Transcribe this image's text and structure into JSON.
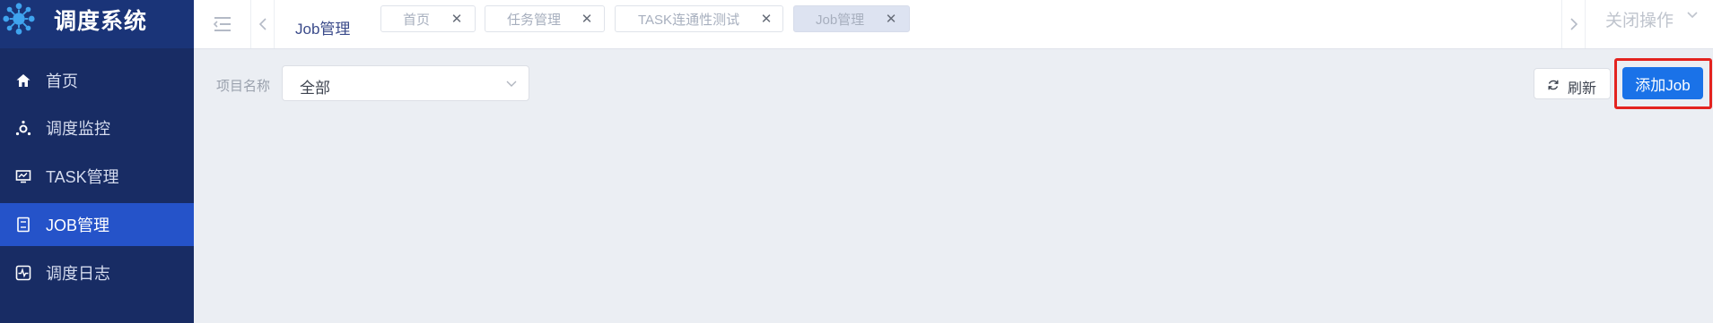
{
  "app": {
    "title": "调度系统"
  },
  "sidebar": {
    "items": [
      {
        "label": "首页",
        "icon": "home-icon",
        "active": false
      },
      {
        "label": "调度监控",
        "icon": "monitor-node-icon",
        "active": false
      },
      {
        "label": "TASK管理",
        "icon": "screen-chart-icon",
        "active": false
      },
      {
        "label": "JOB管理",
        "icon": "document-icon",
        "active": true
      },
      {
        "label": "调度日志",
        "icon": "pulse-log-icon",
        "active": false
      }
    ]
  },
  "header": {
    "breadcrumb": "Job管理",
    "tabs": [
      {
        "label": "首页",
        "active": false
      },
      {
        "label": "任务管理",
        "active": false
      },
      {
        "label": "TASK连通性测试",
        "active": false
      },
      {
        "label": "Job管理",
        "active": true
      }
    ],
    "close_ops_label": "关闭操作"
  },
  "filter": {
    "project_label": "项目名称",
    "project_value": "全部"
  },
  "actions": {
    "refresh_label": "刷新",
    "add_label": "添加Job"
  },
  "colors": {
    "sidebar_bg": "#182c64",
    "sidebar_active": "#2553c9",
    "primary": "#1a72e8",
    "highlight": "#e3231f"
  }
}
